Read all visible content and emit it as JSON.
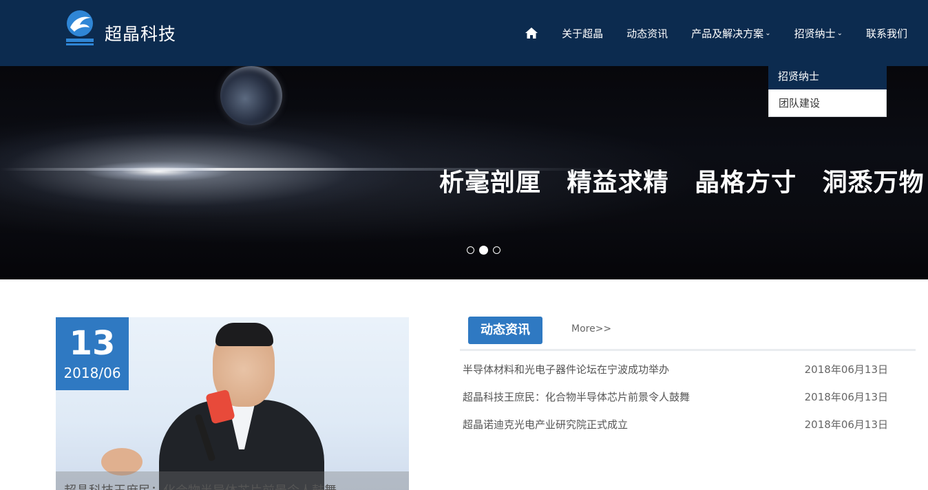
{
  "header": {
    "brand": "超晶科技",
    "nav": [
      {
        "label": "关于超晶"
      },
      {
        "label": "动态资讯"
      },
      {
        "label": "产品及解决方案",
        "has_dropdown": true
      },
      {
        "label": "招贤纳士",
        "has_dropdown": true
      },
      {
        "label": "联系我们"
      }
    ],
    "home_icon": "home-icon",
    "chevron_icon": "chevron-down-icon"
  },
  "dropdown": {
    "items": [
      {
        "label": "招贤纳士",
        "active": true
      },
      {
        "label": "团队建设",
        "active": false
      }
    ]
  },
  "banner": {
    "slogan": "析毫剖厘 精益求精 晶格方寸 洞悉万物",
    "slides": 3,
    "active_slide": 2
  },
  "featured": {
    "day": "13",
    "year_month": "2018/06",
    "caption": "超晶科技王庶民：化合物半导体芯片前景令人鼓舞"
  },
  "news": {
    "tab_label": "动态资讯",
    "more_label": "More>>",
    "items": [
      {
        "title": "半导体材料和光电子器件论坛在宁波成功举办",
        "date": "2018年06月13日"
      },
      {
        "title": "超晶科技王庶民：化合物半导体芯片前景令人鼓舞",
        "date": "2018年06月13日"
      },
      {
        "title": "超晶诺迪克光电产业研究院正式成立",
        "date": "2018年06月13日"
      }
    ]
  },
  "colors": {
    "header_bg": "#0c2b4f",
    "accent": "#2f79c2"
  }
}
